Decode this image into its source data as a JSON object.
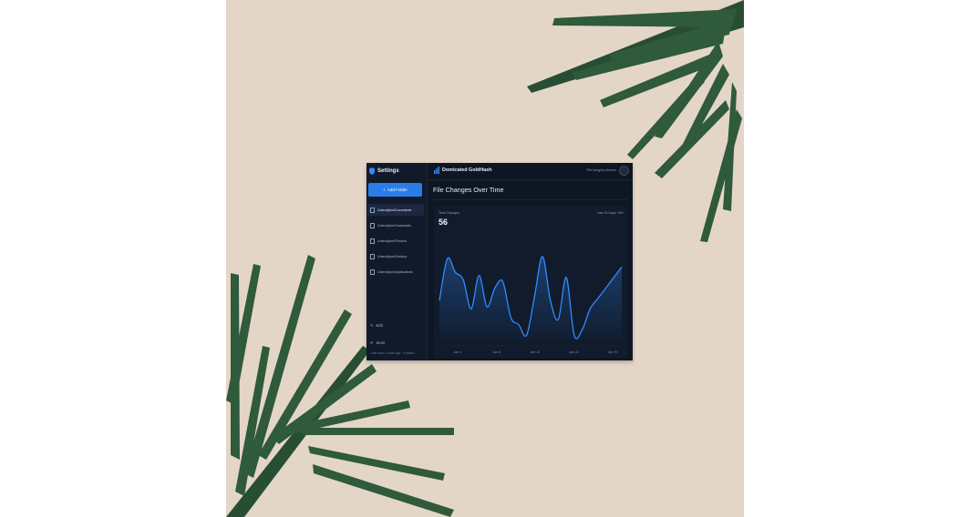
{
  "sidebar": {
    "title": "Settings",
    "add_folder_label": "Add Folder",
    "folders": [
      {
        "label": "/Users/jdoe/Documents"
      },
      {
        "label": "/Users/jdoe/Downloads"
      },
      {
        "label": "/Users/jdoe/Pictures"
      },
      {
        "label": "/Users/jdoe/Desktop"
      },
      {
        "label": "/Users/jdoe/Applications"
      }
    ],
    "edit_label": "Edit",
    "scan_label": "Scan",
    "footer_text": "Last scan: 2 hours ago · 5 folders"
  },
  "header": {
    "app_name": "Domicated GoldHash",
    "user_status": "File Integrity Monitor"
  },
  "main": {
    "title": "File Changes Over Time",
    "metric_label": "Total Changes",
    "metric_value": "56",
    "range_label": "Last 30 Days",
    "range_delta": "+8%"
  },
  "colors": {
    "accent": "#2a7de9",
    "line": "#2f8bff",
    "positive": "#3ec46d",
    "background": "#0e1624"
  },
  "chart_data": {
    "type": "area",
    "title": "File Changes Over Time",
    "xlabel": "",
    "ylabel": "",
    "x_ticks": [
      "Jan 1",
      "Jan 8",
      "Jan 15",
      "Jan 22",
      "Jan 29"
    ],
    "x": [
      0,
      3,
      6,
      9,
      12,
      15,
      18,
      21,
      24,
      27,
      30,
      33,
      36,
      39,
      42,
      45,
      48,
      51,
      54,
      57,
      60,
      63,
      66,
      69
    ],
    "values": [
      3.8,
      7.8,
      6.5,
      5.8,
      3.0,
      6.2,
      3.2,
      5.0,
      5.6,
      2.2,
      1.5,
      0.5,
      4.2,
      8.0,
      3.8,
      2.0,
      6.0,
      0.5,
      1.0,
      3.0,
      4.0,
      5.0,
      6.0,
      7.0
    ],
    "grid": false,
    "legend": "none"
  }
}
